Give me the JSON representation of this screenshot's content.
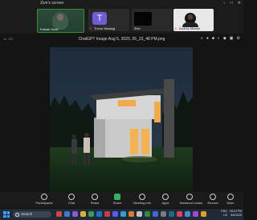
{
  "window": {
    "title": "Zive's screen",
    "controls": [
      "–",
      "□",
      "✕"
    ]
  },
  "participants": [
    {
      "name": "Fabian Scott",
      "avatar": "",
      "muted": false
    },
    {
      "name": "Trevor Mwangi",
      "avatar": "T",
      "muted": true
    },
    {
      "name": "Zive",
      "avatar": "",
      "muted": false
    },
    {
      "name": "Audrey Mbaah",
      "avatar": "",
      "muted": true
    }
  ],
  "share": {
    "file_name": "ChatGPT Image Aug 5, 2025, 05_23_48 PM.png",
    "left_icons": [
      "pin-icon",
      "view-icon"
    ],
    "right_icons": [
      "shield-icon",
      "mic-icon",
      "video-icon",
      "sync-icon",
      "people-icon",
      "chat-icon",
      "settings-icon"
    ]
  },
  "toolbar": {
    "participants": "Participants",
    "chat": "Chat",
    "react": "React",
    "share": "Share",
    "meeting_info": "Meeting info",
    "apps": "Apps",
    "breakout_rooms": "Breakout rooms",
    "record": "Record",
    "more": "More"
  },
  "taskbar": {
    "search_placeholder": "Search",
    "lang_line1": "ENG",
    "lang_line2": "US",
    "time": "05:24 PM",
    "date": "8/5/2025"
  }
}
